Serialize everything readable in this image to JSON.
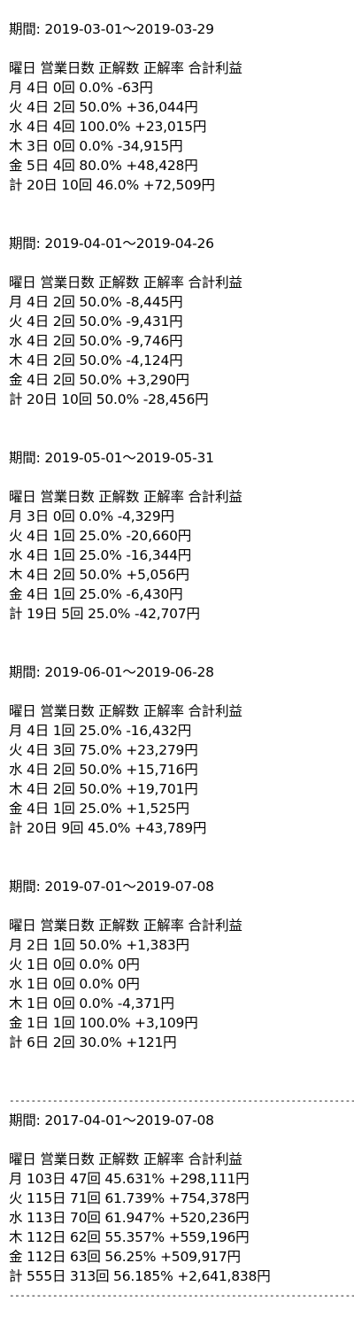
{
  "blocks": [
    {
      "period": "期間: 2019-03-01〜2019-03-29",
      "header": "曜日 営業日数 正解数 正解率 合計利益",
      "rows": [
        "月 4日 0回 0.0% -63円",
        "火 4日 2回 50.0% +36,044円",
        "水 4日 4回 100.0% +23,015円",
        "木 3日 0回 0.0% -34,915円",
        "金 5日 4回 80.0% +48,428円",
        "計 20日 10回 46.0% +72,509円"
      ]
    },
    {
      "period": "期間: 2019-04-01〜2019-04-26",
      "header": "曜日 営業日数 正解数 正解率 合計利益",
      "rows": [
        "月 4日 2回 50.0% -8,445円",
        "火 4日 2回 50.0% -9,431円",
        "水 4日 2回 50.0% -9,746円",
        "木 4日 2回 50.0% -4,124円",
        "金 4日 2回 50.0% +3,290円",
        "計 20日 10回 50.0% -28,456円"
      ]
    },
    {
      "period": "期間: 2019-05-01〜2019-05-31",
      "header": "曜日 営業日数 正解数 正解率 合計利益",
      "rows": [
        "月 3日 0回 0.0% -4,329円",
        "火 4日 1回 25.0% -20,660円",
        "水 4日 1回 25.0% -16,344円",
        "木 4日 2回 50.0% +5,056円",
        "金 4日 1回 25.0% -6,430円",
        "計 19日 5回 25.0% -42,707円"
      ]
    },
    {
      "period": "期間: 2019-06-01〜2019-06-28",
      "header": "曜日 営業日数 正解数 正解率 合計利益",
      "rows": [
        "月 4日 1回 25.0% -16,432円",
        "火 4日 3回 75.0% +23,279円",
        "水 4日 2回 50.0% +15,716円",
        "木 4日 2回 50.0% +19,701円",
        "金 4日 1回 25.0% +1,525円",
        "計 20日 9回 45.0% +43,789円"
      ]
    },
    {
      "period": "期間: 2019-07-01〜2019-07-08",
      "header": "曜日 営業日数 正解数 正解率 合計利益",
      "rows": [
        "月 2日 1回 50.0% +1,383円",
        "火 1日 0回 0.0% 0円",
        "水 1日 0回 0.0% 0円",
        "木 1日 0回 0.0% -4,371円",
        "金 1日 1回 100.0% +3,109円",
        "計 6日 2回 30.0% +121円"
      ]
    }
  ],
  "divider": "----------------------------------------------------------------",
  "summary": {
    "period": "期間: 2017-04-01〜2019-07-08",
    "header": "曜日 営業日数 正解数 正解率 合計利益",
    "rows": [
      "月 103日 47回 45.631% +298,111円",
      "火 115日 71回 61.739% +754,378円",
      "水 113日 70回 61.947% +520,236円",
      "木 112日 62回 55.357% +559,196円",
      "金 112日 63回 56.25% +509,917円",
      "計 555日 313回 56.185% +2,641,838円"
    ]
  }
}
